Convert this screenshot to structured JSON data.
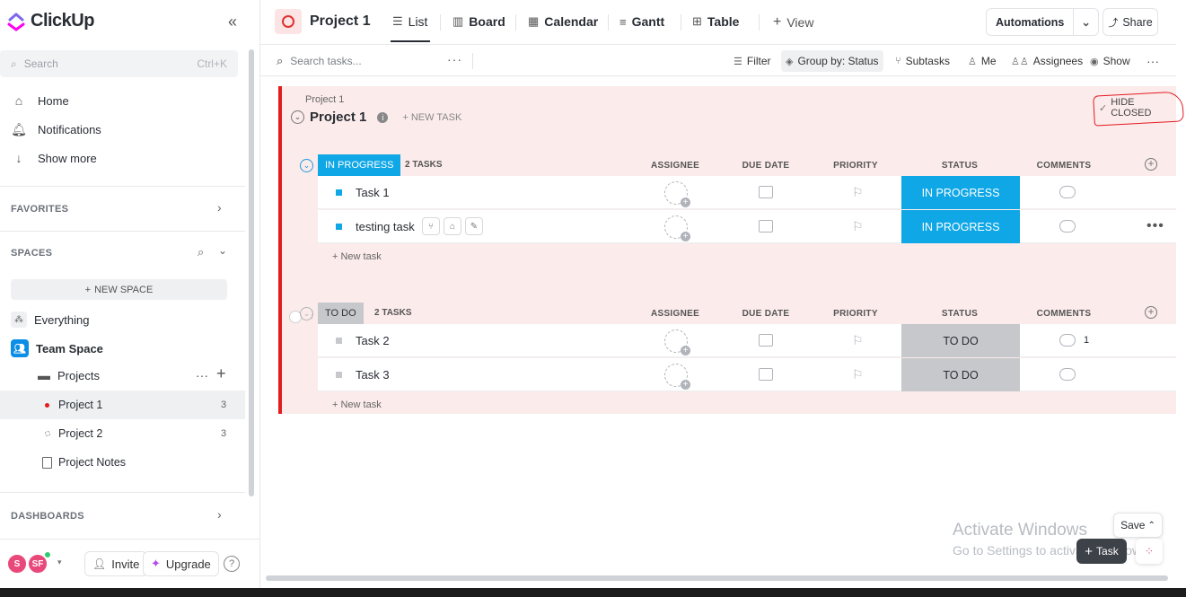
{
  "sidebar": {
    "logo": "ClickUp",
    "search_placeholder": "Search",
    "search_shortcut": "Ctrl+K",
    "nav": [
      {
        "label": "Home",
        "icon": "home-icon"
      },
      {
        "label": "Notifications",
        "icon": "bell-icon"
      },
      {
        "label": "Show more",
        "icon": "arrow-down-icon"
      }
    ],
    "favorites_label": "FAVORITES",
    "spaces_label": "SPACES",
    "new_space_label": "NEW SPACE",
    "everything_label": "Everything",
    "team_space_label": "Team Space",
    "projects_label": "Projects",
    "lists": [
      {
        "label": "Project 1",
        "count": "3"
      },
      {
        "label": "Project 2",
        "count": "3"
      }
    ],
    "project_notes_label": "Project Notes",
    "dashboards_label": "DASHBOARDS",
    "avatars": [
      "S",
      "SF"
    ],
    "invite_label": "Invite",
    "upgrade_label": "Upgrade",
    "help_label": "?"
  },
  "topbar": {
    "project_title": "Project 1",
    "tabs": [
      {
        "label": "List",
        "icon": "list-icon"
      },
      {
        "label": "Board",
        "icon": "board-icon"
      },
      {
        "label": "Calendar",
        "icon": "calendar-icon"
      },
      {
        "label": "Gantt",
        "icon": "gantt-icon"
      },
      {
        "label": "Table",
        "icon": "table-icon"
      }
    ],
    "add_view_label": "View",
    "automations_label": "Automations",
    "share_label": "Share"
  },
  "toolbar": {
    "search_placeholder": "Search tasks...",
    "filter_label": "Filter",
    "group_by_label": "Group by: Status",
    "subtasks_label": "Subtasks",
    "me_label": "Me",
    "assignees_label": "Assignees",
    "show_label": "Show"
  },
  "list": {
    "breadcrumb": "Project 1",
    "title": "Project 1",
    "new_task_label": "+ NEW TASK",
    "hide_closed_label": "HIDE CLOSED",
    "columns": [
      "ASSIGNEE",
      "DUE DATE",
      "PRIORITY",
      "STATUS",
      "COMMENTS"
    ],
    "new_task_row_label": "+ New task",
    "groups": [
      {
        "status": "IN PROGRESS",
        "count_label": "2 TASKS",
        "color": "#0fa7e6",
        "tasks": [
          {
            "name": "Task 1",
            "status": "IN PROGRESS",
            "comments": ""
          },
          {
            "name": "testing task",
            "status": "IN PROGRESS",
            "comments": ""
          }
        ]
      },
      {
        "status": "TO DO",
        "count_label": "2 TASKS",
        "color": "#c6c8cb",
        "tasks": [
          {
            "name": "Task 2",
            "status": "TO DO",
            "comments": "1"
          },
          {
            "name": "Task 3",
            "status": "TO DO",
            "comments": ""
          }
        ]
      }
    ]
  },
  "overlay": {
    "watermark_title": "Activate Windows",
    "watermark_sub": "Go to Settings to activate Windows.",
    "save_label": "Save",
    "task_fab_label": "Task"
  }
}
